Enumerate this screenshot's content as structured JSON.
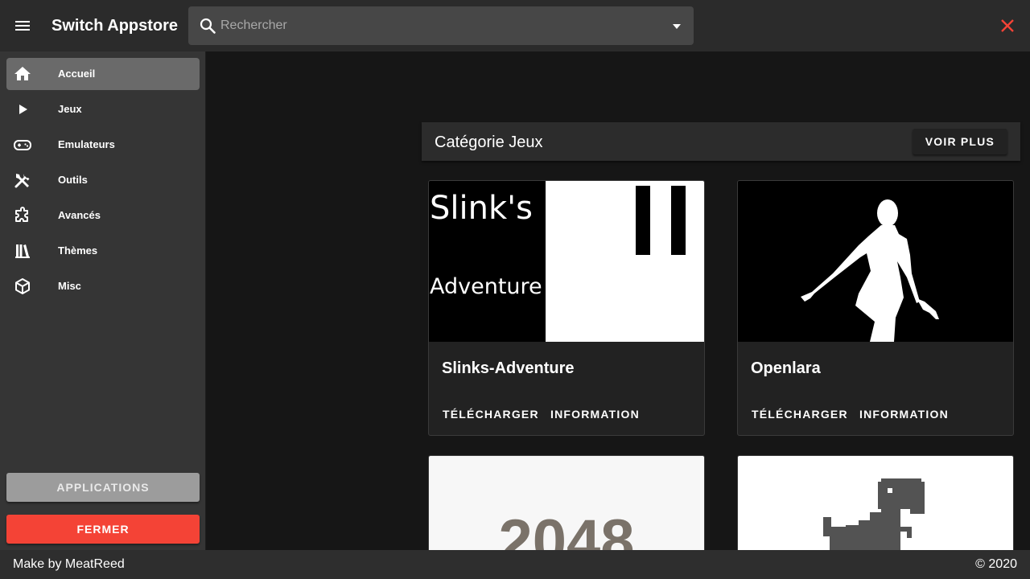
{
  "header": {
    "title": "Switch Appstore",
    "search_placeholder": "Rechercher",
    "icons": {
      "menu": "menu-icon",
      "search": "search-icon",
      "dropdown": "chevron-down-icon",
      "close": "close-icon"
    },
    "close_color": "#f44336"
  },
  "sidebar": {
    "items": [
      {
        "label": "Accueil",
        "icon": "home-icon",
        "active": true
      },
      {
        "label": "Jeux",
        "icon": "play-icon"
      },
      {
        "label": "Emulateurs",
        "icon": "gamepad-icon"
      },
      {
        "label": "Outils",
        "icon": "tools-icon"
      },
      {
        "label": "Avancés",
        "icon": "puzzle-icon"
      },
      {
        "label": "Thèmes",
        "icon": "books-icon"
      },
      {
        "label": "Misc",
        "icon": "cube-icon"
      }
    ],
    "apps_button": "APPLICATIONS",
    "close_button": "FERMER",
    "close_button_color": "#f44336"
  },
  "main": {
    "category_title": "Catégorie Jeux",
    "more_button": "VOIR PLUS",
    "cards": [
      {
        "title": "Slinks-Adventure",
        "thumb_text": [
          "Slink's",
          "Adventure"
        ],
        "download": "TÉLÉCHARGER",
        "info": "INFORMATION"
      },
      {
        "title": "Openlara",
        "download": "TÉLÉCHARGER",
        "info": "INFORMATION"
      },
      {
        "thumb_text": "2048"
      },
      {
        "thumb_icon": "dino-icon"
      }
    ]
  },
  "footer": {
    "left": "Make by MeatReed",
    "right": "© 2020"
  }
}
